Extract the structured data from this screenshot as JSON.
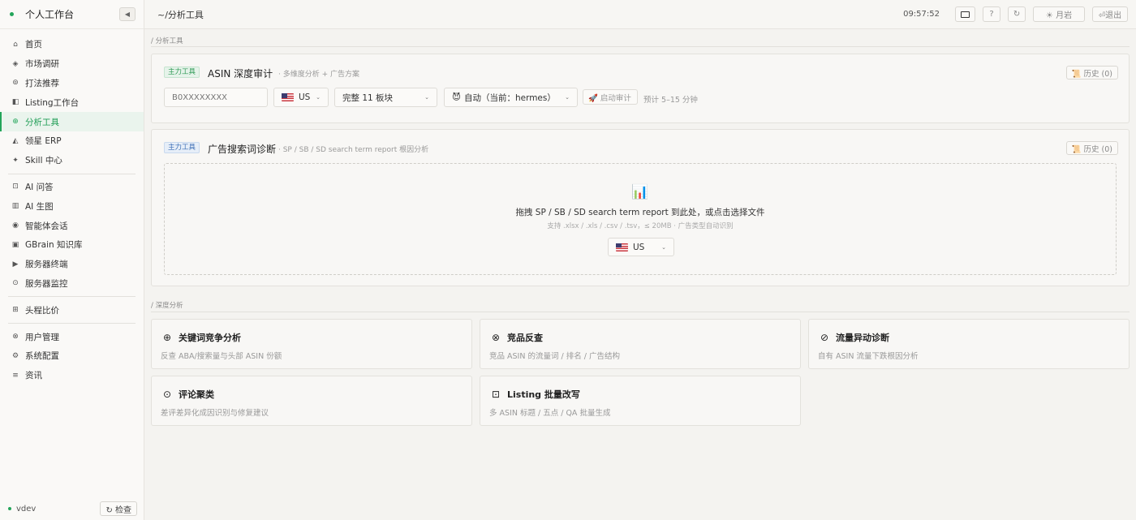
{
  "sidebar": {
    "title": "个人工作台",
    "collapse_icon": "◀",
    "items": [
      {
        "icon": "⌂",
        "label": "首页"
      },
      {
        "icon": "◈",
        "label": "市场调研"
      },
      {
        "icon": "⊚",
        "label": "打法推荐"
      },
      {
        "icon": "◧",
        "label": "Listing工作台"
      },
      {
        "icon": "⊕",
        "label": "分析工具"
      },
      {
        "icon": "◭",
        "label": "领星 ERP"
      },
      {
        "icon": "✦",
        "label": "Skill 中心"
      },
      {
        "icon": "⊡",
        "label": "AI 问答"
      },
      {
        "icon": "▥",
        "label": "AI 生图"
      },
      {
        "icon": "◉",
        "label": "智能体会话"
      },
      {
        "icon": "▣",
        "label": "GBrain 知识库"
      },
      {
        "icon": "▶",
        "label": "服务器终端"
      },
      {
        "icon": "⊙",
        "label": "服务器监控"
      },
      {
        "icon": "⊞",
        "label": "头程比价"
      },
      {
        "icon": "⊗",
        "label": "用户管理"
      },
      {
        "icon": "⚙",
        "label": "系统配置"
      },
      {
        "icon": "≡",
        "label": "资讯"
      }
    ],
    "active_index": 4,
    "version": "vdev",
    "check_label": "↻ 检查"
  },
  "topbar": {
    "breadcrumb": "~/分析工具",
    "time": "09:57:52",
    "help": "?",
    "refresh": "↻",
    "theme": "☀ 月岩",
    "logout": "⏎退出"
  },
  "analysis": {
    "section_label": "/  分析工具",
    "asin": {
      "tag": "主力工具",
      "title": "ASIN 深度审计",
      "subtitle": "· 多维度分析 + 广告方案",
      "history": "📜 历史 (0)",
      "input_placeholder": "B0XXXXXXXX",
      "market": "US",
      "mode": "完整 11 板块",
      "agent_icon": "😈",
      "agent": "自动（当前：hermes）",
      "start": "🚀 启动审计",
      "estimate": "预计 5–15 分钟"
    },
    "ad": {
      "tag": "主力工具",
      "title": "广告搜索词诊断",
      "subtitle": "· SP / SB / SD search term report 根因分析",
      "history": "📜 历史 (0)",
      "drop_icon": "📊",
      "drop_title": "拖拽 SP / SB / SD search term report 到此处，或点击选择文件",
      "drop_hint": "支持 .xlsx / .xls / .csv / .tsv，≤ 20MB · 广告类型自动识别",
      "market": "US"
    }
  },
  "deep": {
    "section_label": "/  深度分析",
    "cards": [
      {
        "icon": "⊕",
        "title": "关键词竞争分析",
        "desc": "反查 ABA/搜索量与头部 ASIN 份额"
      },
      {
        "icon": "⊗",
        "title": "竞品反查",
        "desc": "竞品 ASIN 的流量词 / 排名 / 广告结构"
      },
      {
        "icon": "⊘",
        "title": "流量异动诊断",
        "desc": "自有 ASIN 流量下跌根因分析"
      },
      {
        "icon": "⊙",
        "title": "评论聚类",
        "desc": "差评差异化成因识别与修复建议"
      },
      {
        "icon": "⊡",
        "title": "Listing 批量改写",
        "desc": "多 ASIN 标题 / 五点 / QA 批量生成"
      }
    ]
  },
  "colors": {
    "accent": "#23a55a",
    "tag_blue": "#3d6fb5"
  }
}
